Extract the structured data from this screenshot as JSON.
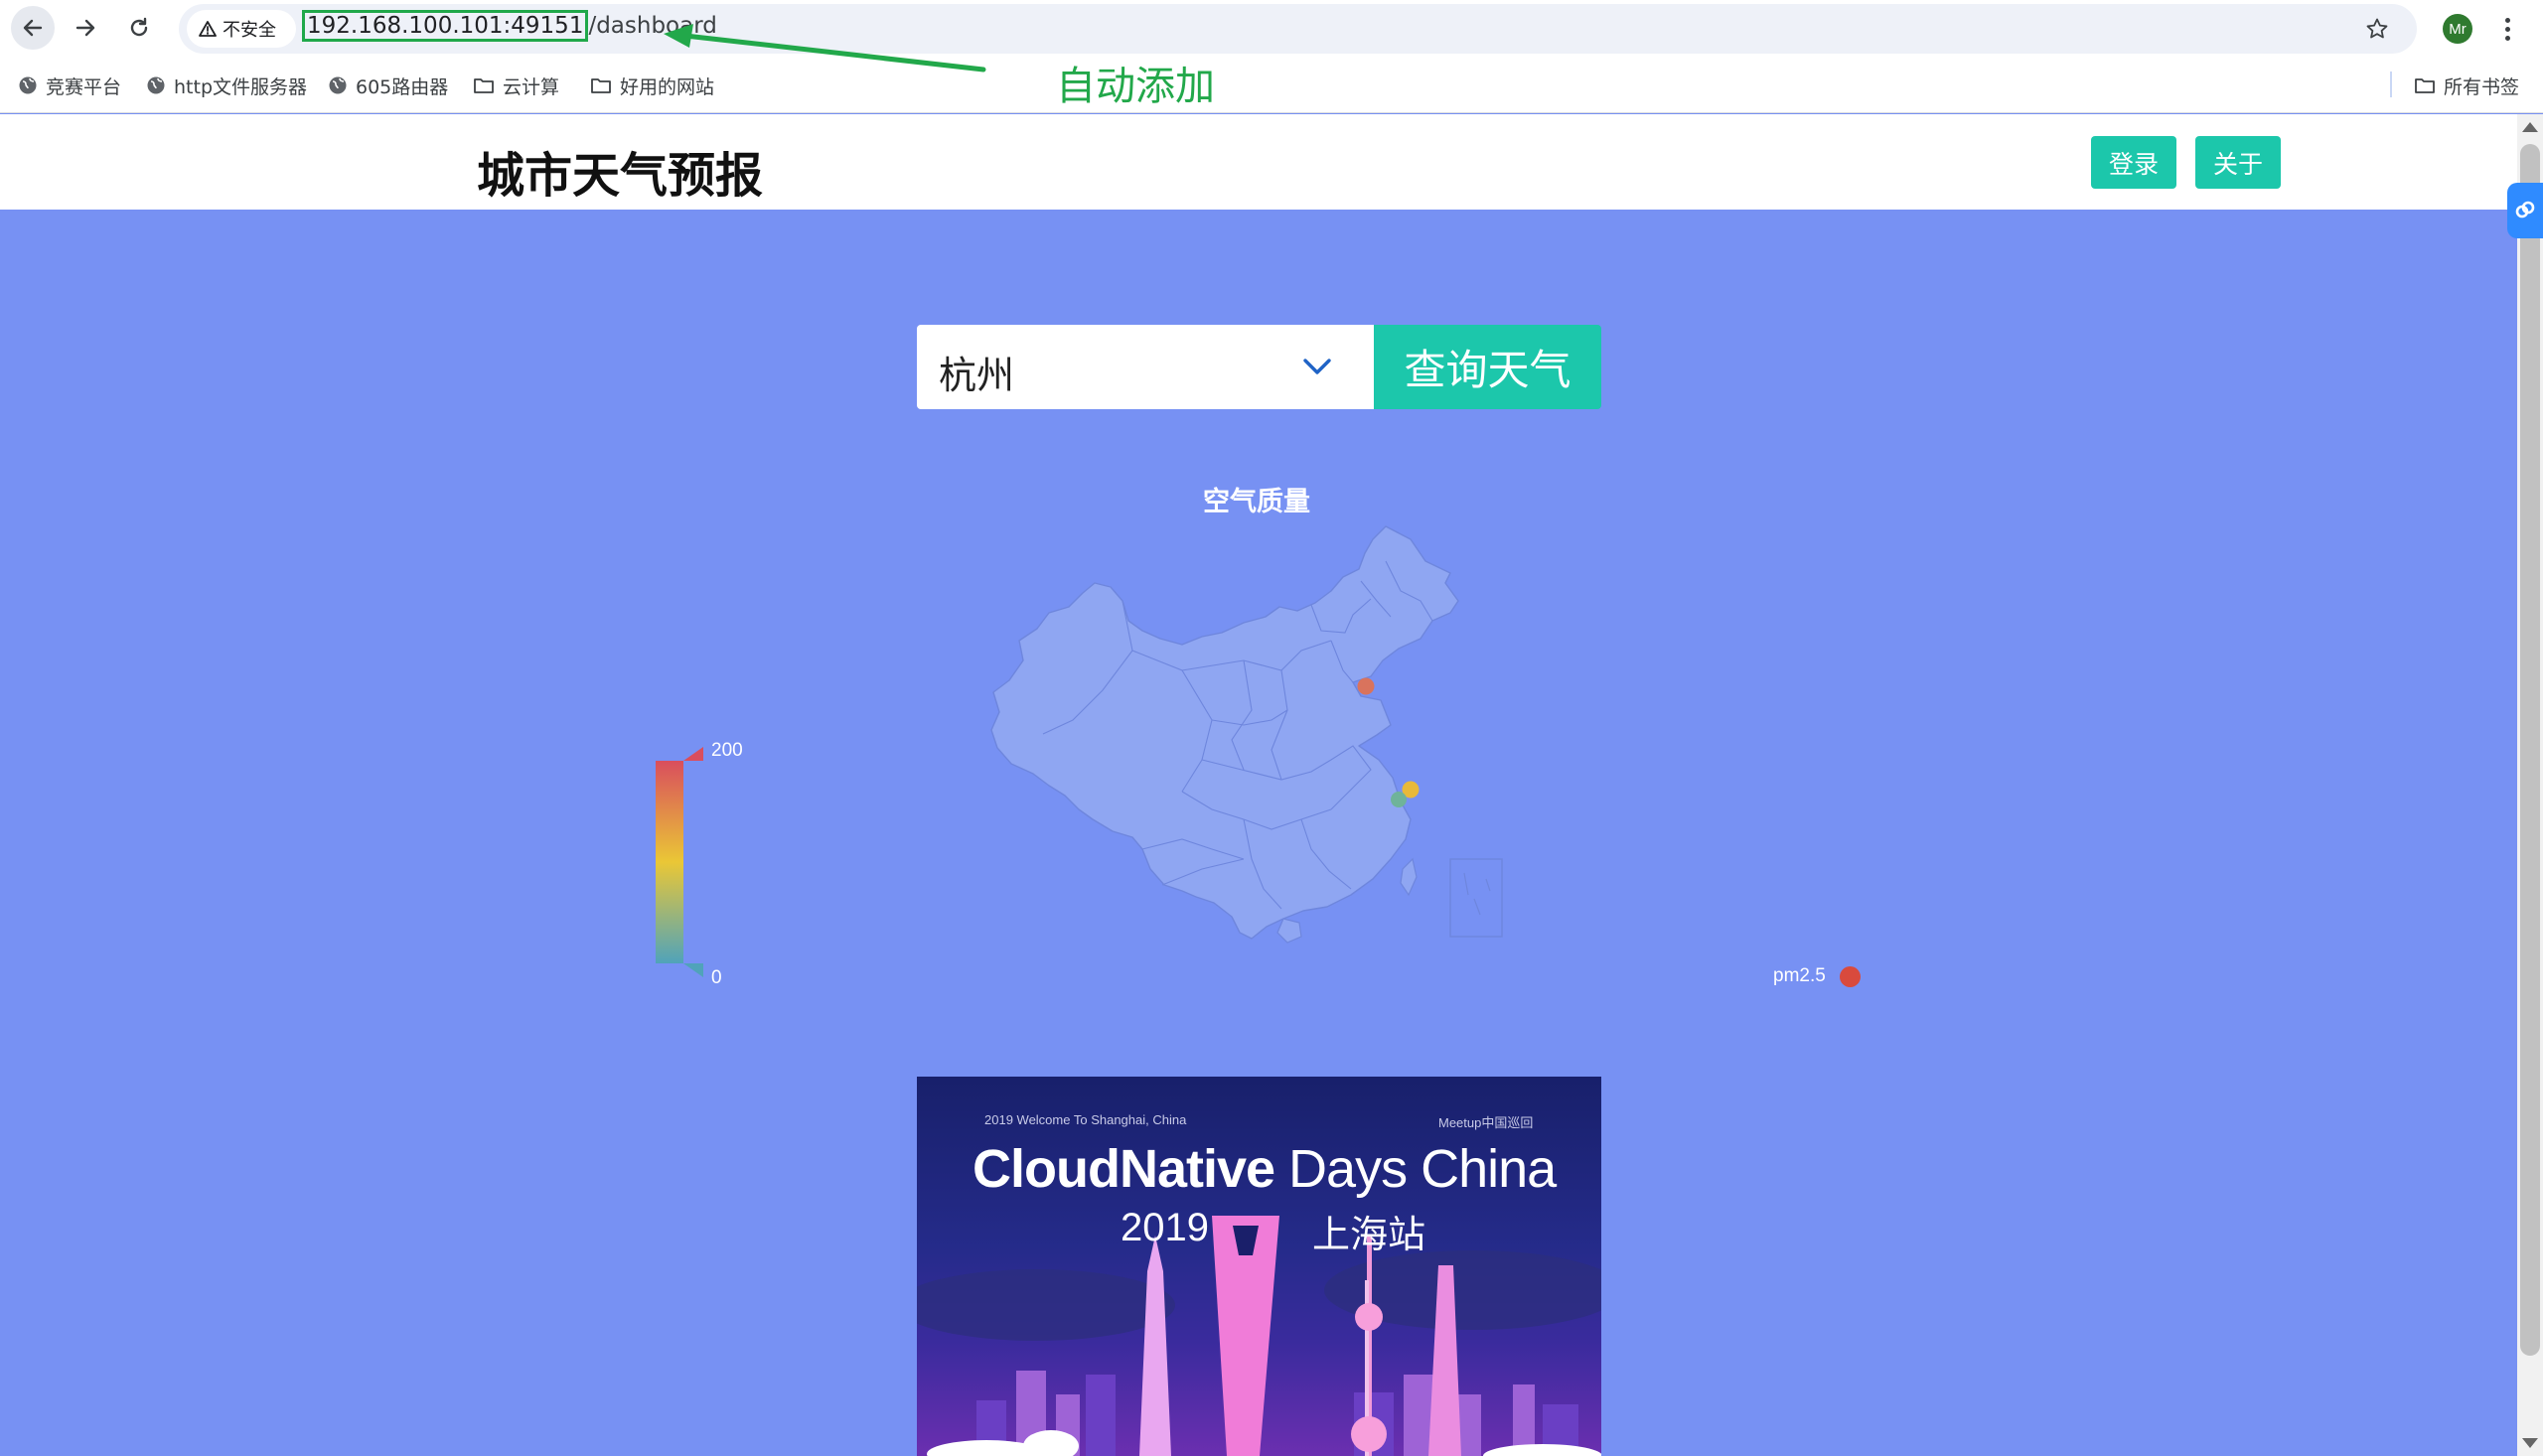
{
  "browser": {
    "security_label": "不安全",
    "url_host": "192.168.100.101:49151",
    "url_path": "/dashboard",
    "profile_initials": "Mr",
    "bookmarks": [
      {
        "label": "竞赛平台",
        "icon": "globe-icon"
      },
      {
        "label": "http文件服务器",
        "icon": "globe-icon"
      },
      {
        "label": "605路由器",
        "icon": "globe-icon"
      },
      {
        "label": "云计算",
        "icon": "folder-icon"
      },
      {
        "label": "好用的网站",
        "icon": "folder-icon"
      }
    ],
    "all_bookmarks_label": "所有书签"
  },
  "annotation": {
    "text": "自动添加",
    "color": "#22a84a"
  },
  "header": {
    "title": "城市天气预报",
    "login_label": "登录",
    "about_label": "关于",
    "accent_color": "#1cc7ab"
  },
  "search": {
    "city_value": "杭州",
    "query_label": "查询天气"
  },
  "chart_data": {
    "type": "map",
    "title": "空气质量",
    "visual_map": {
      "min": 0,
      "max": 200,
      "min_label": "0",
      "max_label": "200",
      "colors": [
        "#50a3ba",
        "#eac736",
        "#d94e5d"
      ]
    },
    "legend": [
      {
        "name": "pm2.5",
        "color": "#d94a3d"
      }
    ],
    "points": [
      {
        "region": "North China (Beijing/Tianjin area)",
        "color": "#d9735d"
      },
      {
        "region": "East China coast (Shanghai area)",
        "color": "#e8b93a"
      },
      {
        "region": "East China coast (Hangzhou area)",
        "color": "#6fb39a"
      }
    ]
  },
  "banner": {
    "top_left": "2019 Welcome To Shanghai, China",
    "top_right": "Meetup中国巡回",
    "headline_bold": "CloudNative",
    "headline_rest": " Days China",
    "year": "2019",
    "city": "上海站"
  },
  "page": {
    "background": "#7791f3"
  }
}
